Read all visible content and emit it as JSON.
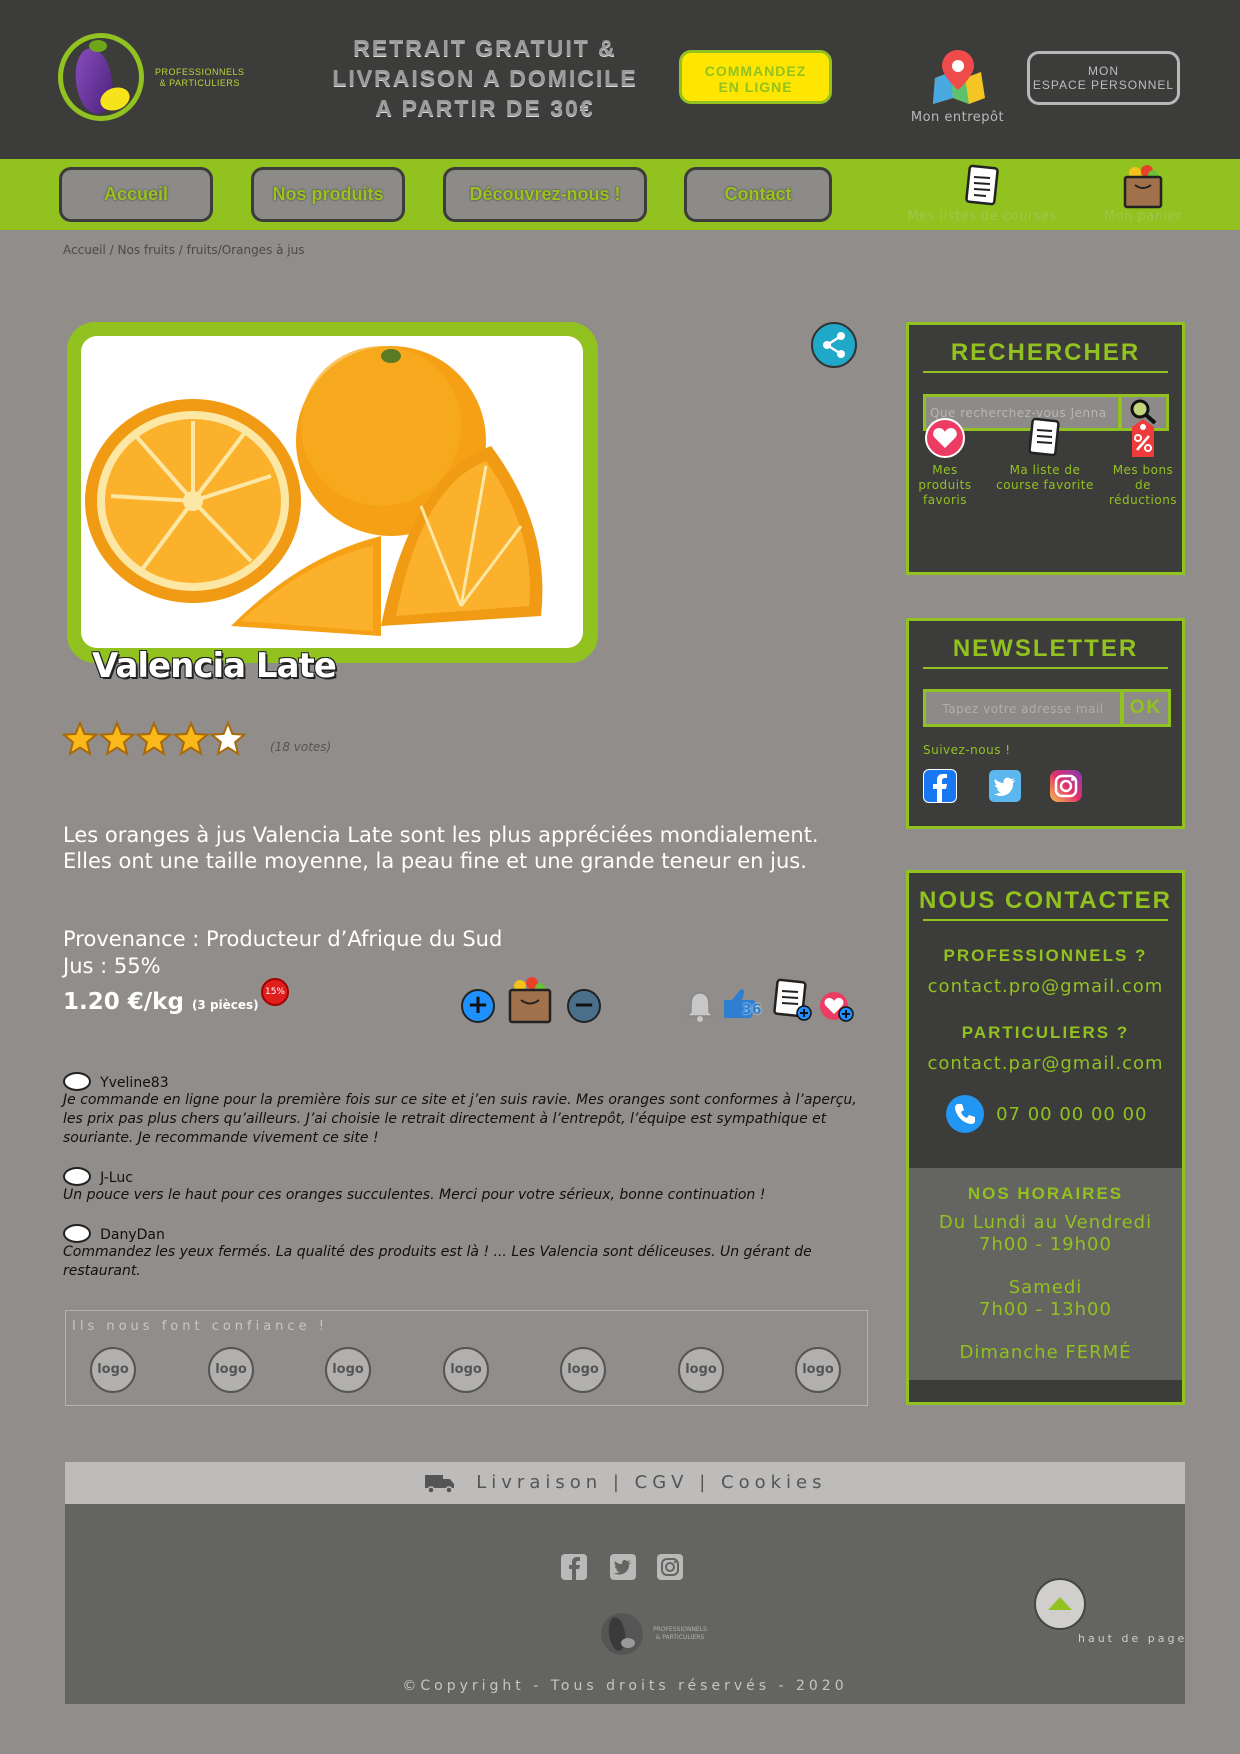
{
  "header": {
    "logo_text_line1": "PROFESSIONNELS",
    "logo_text_line2": "& PARTICULIERS",
    "promo_line1": "RETRAIT GRATUIT &",
    "promo_line2": "LIVRAISON A DOMICILE",
    "promo_line3": "A PARTIR DE 30€",
    "order_line1": "COMMANDEZ",
    "order_line2": "EN LIGNE",
    "warehouse_label": "Mon entrepôt",
    "account_line1": "MON",
    "account_line2": "ESPACE PERSONNEL"
  },
  "nav": {
    "items": [
      {
        "label": "Accueil"
      },
      {
        "label": "Nos produits"
      },
      {
        "label": "Découvrez-nous !"
      },
      {
        "label": "Contact"
      }
    ],
    "shopping_lists_label": "Mes listes de courses",
    "cart_label": "Mon panier"
  },
  "breadcrumb": "Accueil / Nos fruits / fruits/Oranges à jus",
  "product": {
    "title": "Valencia Late",
    "rating": 4,
    "rating_max": 5,
    "votes": "(18 votes)",
    "description": "Les oranges à jus Valencia Late sont les plus appréciées mondialement. Elles ont une taille moyenne, la peau fine et une grande teneur en jus.",
    "provenance": "Provenance : Producteur d’Afrique du Sud",
    "juice": "Jus : 55%",
    "price": "1.20 €/kg",
    "pieces": "(3 pièces)",
    "discount": "15%",
    "likes_count": "36"
  },
  "comments": [
    {
      "author": "Yveline83",
      "text": "Je commande en ligne pour la première fois sur ce site et j’en suis ravie. Mes oranges sont conformes à l’aperçu, les prix pas plus chers qu’ailleurs. J’ai choisie le retrait directement à l’entrepôt, l’équipe est sympathique et souriante. Je recommande vivement ce site !"
    },
    {
      "author": "J-Luc",
      "text": "Un pouce vers le haut pour ces oranges succulentes. Merci pour votre sérieux, bonne continuation !"
    },
    {
      "author": "DanyDan",
      "text": "Commandez les yeux fermés. La qualité des produits est là !  ... Les Valencia sont déliceuses. Un gérant de restaurant."
    }
  ],
  "partners": {
    "title": "Ils nous font confiance !",
    "logos": [
      "logo",
      "logo",
      "logo",
      "logo",
      "logo",
      "logo",
      "logo"
    ]
  },
  "sidebar": {
    "search": {
      "title": "RECHERCHER",
      "placeholder": "Que recherchez-vous Jenna ?",
      "quick_links": [
        {
          "label": "Mes produits favoris",
          "icon": "heart-icon"
        },
        {
          "label": "Ma liste de course favorite",
          "icon": "list-icon"
        },
        {
          "label": "Mes bons de réductions",
          "icon": "discount-tag-icon"
        }
      ]
    },
    "newsletter": {
      "title": "NEWSLETTER",
      "placeholder": "Tapez votre adresse mail",
      "ok": "OK",
      "follow": "Suivez-nous !"
    },
    "contact": {
      "title": "NOUS CONTACTER",
      "pro_label": "PROFESSIONNELS ?",
      "pro_email": "contact.pro@gmail.com",
      "par_label": "PARTICULIERS ?",
      "par_email": "contact.par@gmail.com",
      "phone": "07 00 00 00 00",
      "hours_title": "NOS HORAIRES",
      "weekdays": "Du Lundi au Vendredi",
      "weekdays_hours": "7h00 - 19h00",
      "saturday": "Samedi",
      "saturday_hours": "7h00 - 13h00",
      "sunday": "Dimanche FERMÉ"
    }
  },
  "footer": {
    "links": "Livraison | CGV | Cookies",
    "logo_line1": "PROFESSIONNELS",
    "logo_line2": "& PARTICULIERS",
    "copyright": "©Copyright - Tous droits réservés - 2020",
    "back_to_top": "haut de page"
  },
  "colors": {
    "brand_green": "#91c21f",
    "dark": "#3c3c3b",
    "background": "#908d8a",
    "order_yellow": "#ffe600"
  }
}
